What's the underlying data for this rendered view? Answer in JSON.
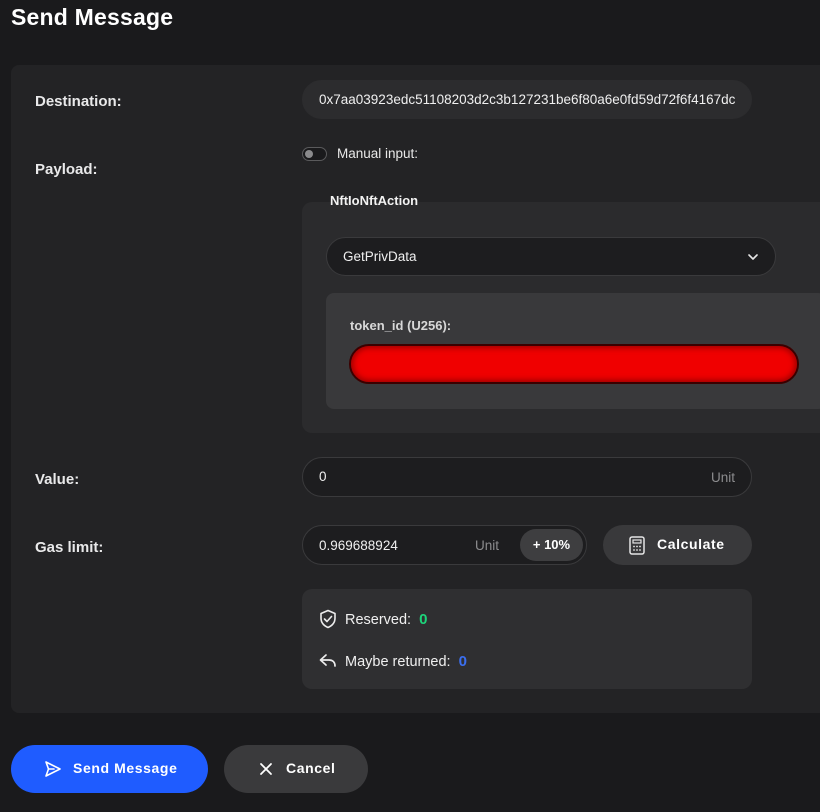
{
  "page": {
    "title": "Send Message"
  },
  "form": {
    "destination": {
      "label": "Destination:",
      "value": "0x7aa03923edc51108203d2c3b127231be6f80a6e0fd59d72f6f4167dc"
    },
    "payload": {
      "label": "Payload:",
      "manual_input_label": "Manual input:",
      "manual_input_enabled": false,
      "type_title": "NftIoNftAction",
      "action_selected": "GetPrivData",
      "field_label": "token_id (U256):",
      "field_value_redacted": true
    },
    "value": {
      "label": "Value:",
      "value": "0",
      "unit": "Unit"
    },
    "gas_limit": {
      "label": "Gas limit:",
      "value": "0.969688924",
      "unit": "Unit",
      "increase_label": "+ 10%",
      "calculate_label": "Calculate"
    },
    "info": {
      "reserved_label": "Reserved:",
      "reserved_value": "0",
      "maybe_returned_label": "Maybe returned:",
      "maybe_returned_value": "0"
    }
  },
  "actions": {
    "send_label": "Send Message",
    "cancel_label": "Cancel"
  },
  "colors": {
    "primary": "#1f5cff",
    "green": "#1dd47a",
    "blue": "#3b6ff0",
    "redaction": "#f00000"
  },
  "icons": [
    "chevron-down-icon",
    "calculator-icon",
    "shield-check-icon",
    "reply-icon",
    "send-icon",
    "close-icon"
  ]
}
